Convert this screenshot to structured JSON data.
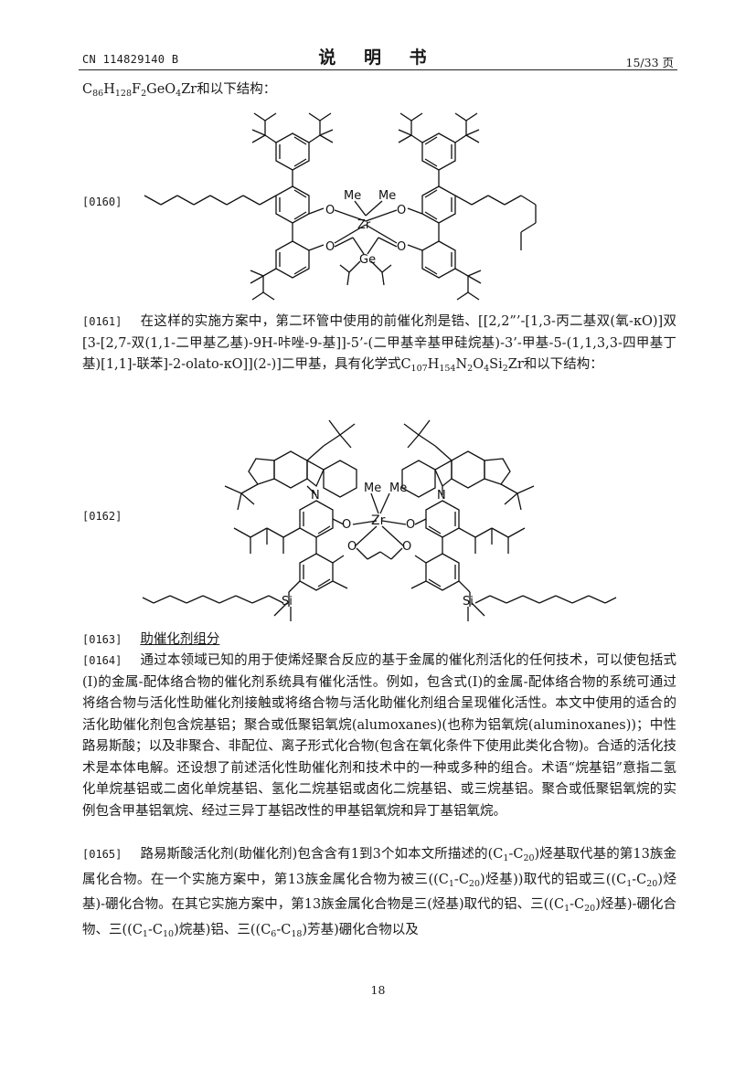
{
  "header": {
    "patent_no": "CN 114829140 B",
    "doc_title": "说 明 书",
    "page_info": "15/33 页"
  },
  "formula_intro": {
    "formula_html": "C<sub>86</sub>H<sub>128</sub>F<sub>2</sub>GeO<sub>4</sub>Zr和以下结构："
  },
  "figures": {
    "fig1": {
      "number": "[0160]",
      "labels": {
        "me1": "Me",
        "me2": "Me",
        "zr": "Zr",
        "ge": "Ge",
        "o1": "O",
        "o2": "O",
        "o3": "O",
        "o4": "O"
      }
    },
    "fig2": {
      "number": "[0162]",
      "labels": {
        "me1": "Me",
        "me2": "Me",
        "zr": "Zr",
        "n1": "N",
        "n2": "N",
        "o1": "O",
        "o2": "O",
        "o3": "O",
        "o4": "O",
        "si1": "Si",
        "si2": "Si"
      }
    }
  },
  "paragraphs": {
    "p0161": {
      "number": "[0161]",
      "html": "在这样的实施方案中，第二环管中使用的前催化剂是锆、[[2,2”’-[1,3-丙二基双(氧-κO)]双[3-[2,7-双(1,1-二甲基乙基)-9H-咔唑-9-基]]-5’-(二甲基辛基甲硅烷基)-3’-甲基-5-(1,1,3,3-四甲基丁基)[1,1]-联苯]-2-olato-κO]](2-)]二甲基，具有化学式C<sub>107</sub>H<sub>154</sub>N<sub>2</sub>O<sub>4</sub>Si<sub>2</sub>Zr和以下结构："
    },
    "p0163": {
      "number": "[0163]",
      "heading": "助催化剂组分"
    },
    "p0164": {
      "number": "[0164]",
      "html": "通过本领域已知的用于使烯烃聚合反应的基于金属的催化剂活化的任何技术，可以使包括式(I)的金属-配体络合物的催化剂系统具有催化活性。例如，包含式(I)的金属-配体络合物的系统可通过将络合物与活化性助催化剂接触或将络合物与活化助催化剂组合呈现催化活性。本文中使用的适合的活化助催化剂包含烷基铝；聚合或低聚铝氧烷(alumoxanes)(也称为铝氧烷(aluminoxanes))；中性路易斯酸；以及非聚合、非配位、离子形式化合物(包含在氧化条件下使用此类化合物)。合适的活化技术是本体电解。还设想了前述活化性助催化剂和技术中的一种或多种的组合。术语“烷基铝”意指二氢化单烷基铝或二卤化单烷基铝、氢化二烷基铝或卤化二烷基铝、或三烷基铝。聚合或低聚铝氧烷的实例包含甲基铝氧烷、经过三异丁基铝改性的甲基铝氧烷和异丁基铝氧烷。"
    },
    "p0165": {
      "number": "[0165]",
      "html": "路易斯酸活化剂(助催化剂)包含含有1到3个如本文所描述的(C<sub>1</sub>-C<sub>20</sub>)烃基取代基的第13族金属化合物。在一个实施方案中，第13族金属化合物为被三((C<sub>1</sub>-C<sub>20</sub>)烃基))取代的铝或三((C<sub>1</sub>-C<sub>20</sub>)烃基)-硼化合物。在其它实施方案中，第13族金属化合物是三(烃基)取代的铝、三((C<sub>1</sub>-C<sub>20</sub>)烃基)-硼化合物、三((C<sub>1</sub>-C<sub>10</sub>)烷基)铝、三((C<sub>6</sub>-C<sub>18</sub>)芳基)硼化合物以及"
    }
  },
  "footer": {
    "page_number": "18"
  }
}
